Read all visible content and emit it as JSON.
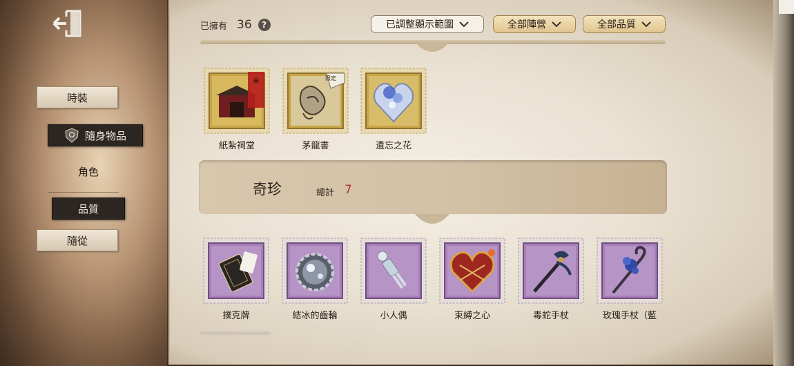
{
  "sidebar": {
    "exit_icon": "exit-door-icon",
    "items": [
      {
        "label": "時裝",
        "state": "normal"
      },
      {
        "label": "隨身物品",
        "state": "selected",
        "icon": "emblem-icon"
      },
      {
        "label": "角色",
        "state": "plain"
      },
      {
        "label": "品質",
        "state": "selected"
      },
      {
        "label": "隨從",
        "state": "normal"
      }
    ]
  },
  "header": {
    "owned_label": "已擁有",
    "owned_count": "36",
    "help_icon": "?",
    "filters": [
      {
        "label": "已調整顯示範圍"
      },
      {
        "label": "全部陣營"
      },
      {
        "label": "全部品質"
      }
    ]
  },
  "sections": [
    {
      "quality": "gold",
      "items": [
        {
          "name": "紙紮祠堂",
          "icon": "paper-shrine-icon",
          "badge": ""
        },
        {
          "name": "茅龍書",
          "icon": "straw-dragon-book-icon",
          "badge": "限定"
        },
        {
          "name": "遺忘之花",
          "icon": "crystal-heart-flower-icon",
          "badge": ""
        }
      ]
    },
    {
      "title": "奇珍",
      "total_label": "總計",
      "total": "7",
      "quality": "purple",
      "items": [
        {
          "name": "撲克牌",
          "icon": "poker-cards-icon"
        },
        {
          "name": "結冰的齒輪",
          "icon": "frozen-gear-icon"
        },
        {
          "name": "小人偶",
          "icon": "small-doll-icon"
        },
        {
          "name": "束縛之心",
          "icon": "bound-heart-icon"
        },
        {
          "name": "毒蛇手杖",
          "icon": "viper-cane-icon"
        },
        {
          "name": "玫瑰手杖（藍",
          "icon": "rose-cane-icon"
        }
      ]
    }
  ],
  "colors": {
    "gold_stamp": "#c9a447",
    "purple_stamp": "#a67fb8",
    "accent_red": "#a8382e"
  }
}
